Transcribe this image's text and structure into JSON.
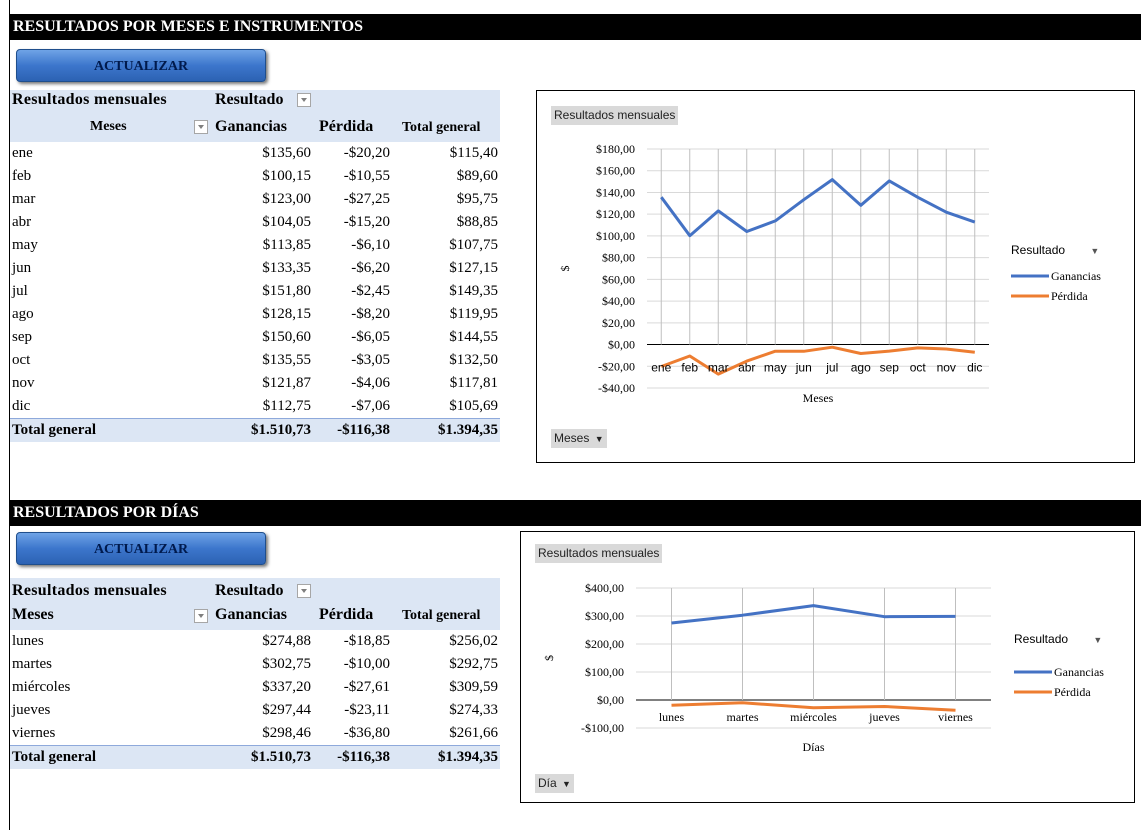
{
  "colors": {
    "ganancias": "#4472c4",
    "perdida": "#ed7d31",
    "header_bg": "#dce6f4",
    "banner_bg": "#000000"
  },
  "section_months": {
    "banner": "RESULTADOS POR MESES E INSTRUMENTOS",
    "button": "ACTUALIZAR",
    "pivot": {
      "title": "Resultados mensuales",
      "filter_label": "Resultado",
      "row_header": "Meses",
      "col_ganancias": "Ganancias",
      "col_perdida": "Pérdida",
      "col_total": "Total general",
      "rows": [
        {
          "name": "ene",
          "g": "$135,60",
          "p": "-$20,20",
          "t": "$115,40"
        },
        {
          "name": "feb",
          "g": "$100,15",
          "p": "-$10,55",
          "t": "$89,60"
        },
        {
          "name": "mar",
          "g": "$123,00",
          "p": "-$27,25",
          "t": "$95,75"
        },
        {
          "name": "abr",
          "g": "$104,05",
          "p": "-$15,20",
          "t": "$88,85"
        },
        {
          "name": "may",
          "g": "$113,85",
          "p": "-$6,10",
          "t": "$107,75"
        },
        {
          "name": "jun",
          "g": "$133,35",
          "p": "-$6,20",
          "t": "$127,15"
        },
        {
          "name": "jul",
          "g": "$151,80",
          "p": "-$2,45",
          "t": "$149,35"
        },
        {
          "name": "ago",
          "g": "$128,15",
          "p": "-$8,20",
          "t": "$119,95"
        },
        {
          "name": "sep",
          "g": "$150,60",
          "p": "-$6,05",
          "t": "$144,55"
        },
        {
          "name": "oct",
          "g": "$135,55",
          "p": "-$3,05",
          "t": "$132,50"
        },
        {
          "name": "nov",
          "g": "$121,87",
          "p": "-$4,06",
          "t": "$117,81"
        },
        {
          "name": "dic",
          "g": "$112,75",
          "p": "-$7,06",
          "t": "$105,69"
        }
      ],
      "total": {
        "name": "Total general",
        "g": "$1.510,73",
        "p": "-$116,38",
        "t": "$1.394,35"
      }
    },
    "chart_chip": "Resultados mensuales",
    "field_chip": "Meses",
    "legend_title": "Resultado"
  },
  "section_days": {
    "banner": "RESULTADOS POR  DÍAS",
    "button": "ACTUALIZAR",
    "pivot": {
      "title": "Resultados mensuales",
      "filter_label": "Resultado",
      "row_header": "Meses",
      "col_ganancias": "Ganancias",
      "col_perdida": "Pérdida",
      "col_total": "Total general",
      "rows": [
        {
          "name": "lunes",
          "g": "$274,88",
          "p": "-$18,85",
          "t": "$256,02"
        },
        {
          "name": "martes",
          "g": "$302,75",
          "p": "-$10,00",
          "t": "$292,75"
        },
        {
          "name": "miércoles",
          "g": "$337,20",
          "p": "-$27,61",
          "t": "$309,59"
        },
        {
          "name": "jueves",
          "g": "$297,44",
          "p": "-$23,11",
          "t": "$274,33"
        },
        {
          "name": "viernes",
          "g": "$298,46",
          "p": "-$36,80",
          "t": "$261,66"
        }
      ],
      "total": {
        "name": "Total general",
        "g": "$1.510,73",
        "p": "-$116,38",
        "t": "$1.394,35"
      }
    },
    "chart_chip": "Resultados mensuales",
    "field_chip": "Día",
    "legend_title": "Resultado"
  },
  "chart_data": [
    {
      "type": "line",
      "categories": [
        "ene",
        "feb",
        "mar",
        "abr",
        "may",
        "jun",
        "jul",
        "ago",
        "sep",
        "oct",
        "nov",
        "dic"
      ],
      "series": [
        {
          "name": "Ganancias",
          "values": [
            135.6,
            100.15,
            123.0,
            104.05,
            113.85,
            133.35,
            151.8,
            128.15,
            150.6,
            135.55,
            121.87,
            112.75
          ]
        },
        {
          "name": "Pérdida",
          "values": [
            -20.2,
            -10.55,
            -27.25,
            -15.2,
            -6.1,
            -6.2,
            -2.45,
            -8.2,
            -6.05,
            -3.05,
            -4.06,
            -7.06
          ]
        }
      ],
      "xlabel": "Meses",
      "ylabel": "$",
      "ylim": [
        -40,
        180
      ],
      "yticks": [
        -40,
        -20,
        0,
        20,
        40,
        60,
        80,
        100,
        120,
        140,
        160,
        180
      ],
      "ytick_labels": [
        "-$40,00",
        "-$20,00",
        "$0,00",
        "$20,00",
        "$40,00",
        "$60,00",
        "$80,00",
        "$100,00",
        "$120,00",
        "$140,00",
        "$160,00",
        "$180,00"
      ],
      "grid": true,
      "legend": "right"
    },
    {
      "type": "line",
      "categories": [
        "lunes",
        "martes",
        "miércoles",
        "jueves",
        "viernes"
      ],
      "series": [
        {
          "name": "Ganancias",
          "values": [
            274.88,
            302.75,
            337.2,
            297.44,
            298.46
          ]
        },
        {
          "name": "Pérdida",
          "values": [
            -18.85,
            -10.0,
            -27.61,
            -23.11,
            -36.8
          ]
        }
      ],
      "xlabel": "Días",
      "ylabel": "$",
      "ylim": [
        -100,
        400
      ],
      "yticks": [
        -100,
        0,
        100,
        200,
        300,
        400
      ],
      "ytick_labels": [
        "-$100,00",
        "$0,00",
        "$100,00",
        "$200,00",
        "$300,00",
        "$400,00"
      ],
      "grid": true,
      "legend": "right"
    }
  ]
}
